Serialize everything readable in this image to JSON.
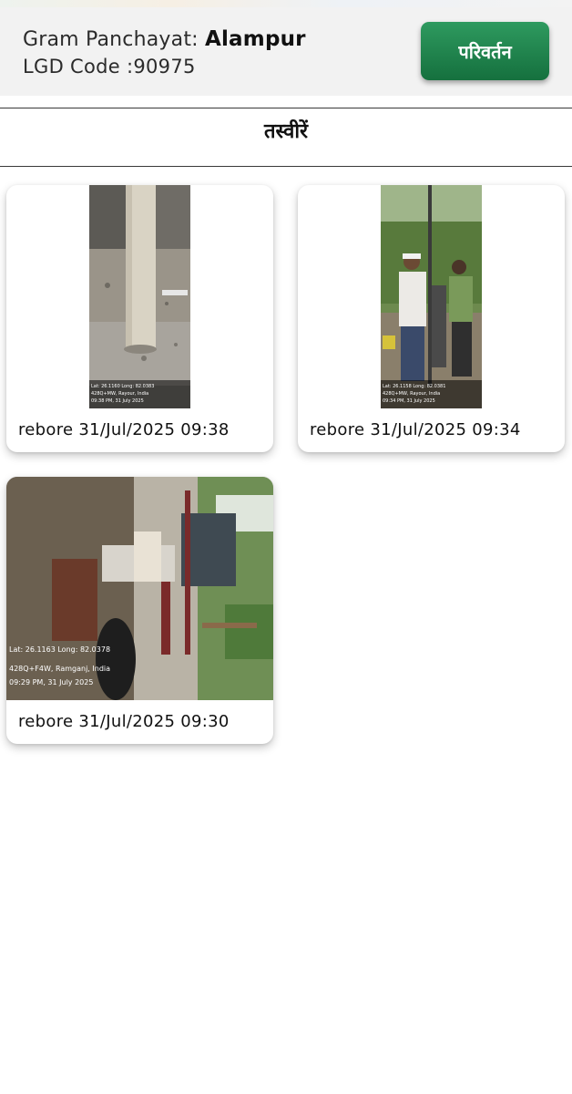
{
  "header": {
    "panchayat_label": "Gram Panchayat: ",
    "panchayat_name": "Alampur",
    "lgd_label": "LGD Code :",
    "lgd_code": "90975",
    "change_button": "परिवर्तन",
    "button_color": "#1a7a45"
  },
  "section": {
    "title": "तस्वीरें"
  },
  "photos": [
    {
      "caption": "rebore 31/Jul/2025 09:38",
      "stamp_line1": "Lat: 26.1160 Long: 82.0383",
      "stamp_line2": "428Q+MW, Rayour, India",
      "stamp_line3": "09:38 PM, 31 July 2025"
    },
    {
      "caption": "rebore 31/Jul/2025 09:34",
      "stamp_line1": "Lat: 26.1158 Long: 82.0381",
      "stamp_line2": "428Q+MW, Rayour, India",
      "stamp_line3": "09:34 PM, 31 July 2025"
    },
    {
      "caption": "rebore 31/Jul/2025 09:30",
      "stamp_line1": "Lat: 26.1163 Long: 82.0378",
      "stamp_line2": "428Q+F4W, Ramganj, India",
      "stamp_line3": "09:29 PM, 31 July 2025"
    }
  ]
}
